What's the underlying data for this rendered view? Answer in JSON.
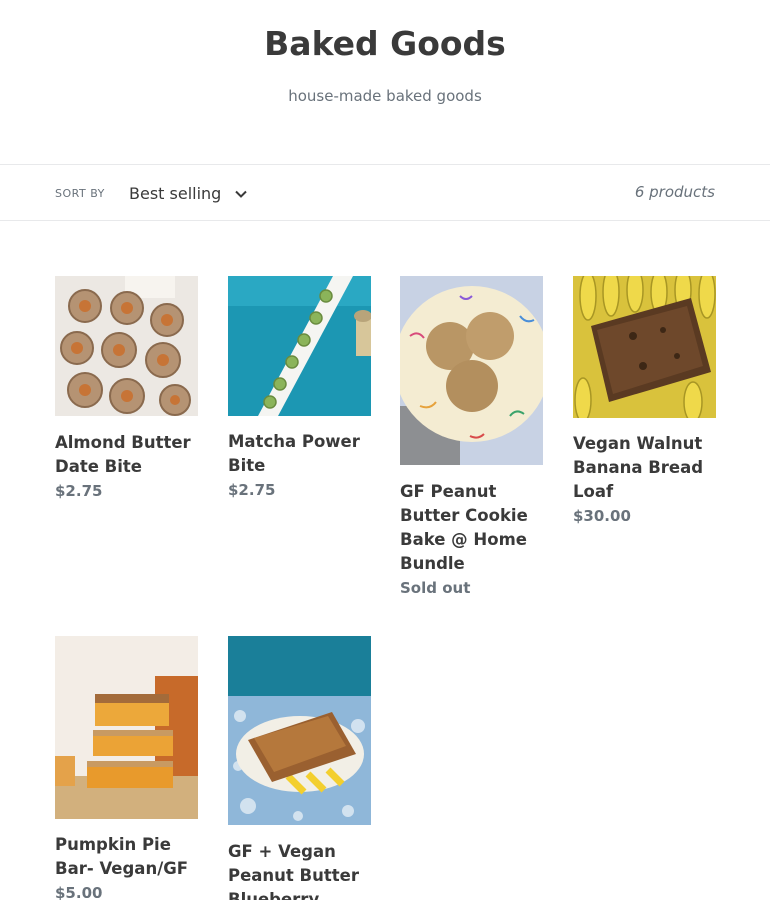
{
  "collection": {
    "title": "Baked Goods",
    "description": "house-made baked goods"
  },
  "filter": {
    "sort_label": "SORT BY",
    "sort_value": "Best selling",
    "product_count": "6 products"
  },
  "products": [
    {
      "name": "Almond Butter Date Bite",
      "price": "$2.75",
      "image_icon": "date-bites-photo"
    },
    {
      "name": "Matcha Power Bite",
      "price": "$2.75",
      "image_icon": "matcha-bites-photo"
    },
    {
      "name": "GF Peanut Butter Cookie Bake @ Home Bundle",
      "price": "Sold out",
      "image_icon": "cookies-plate-photo"
    },
    {
      "name": "Vegan Walnut Banana Bread Loaf",
      "price": "$30.00",
      "image_icon": "banana-bread-photo"
    },
    {
      "name": "Pumpkin Pie Bar- Vegan/GF",
      "price": "$5.00",
      "image_icon": "pumpkin-bars-photo"
    },
    {
      "name": "GF + Vegan Peanut Butter Blueberry Bread",
      "price": "",
      "image_icon": "blueberry-bread-photo"
    }
  ],
  "colors": {
    "text": "#3a3a3a",
    "muted": "#69727b",
    "border": "#e8e9eb"
  }
}
